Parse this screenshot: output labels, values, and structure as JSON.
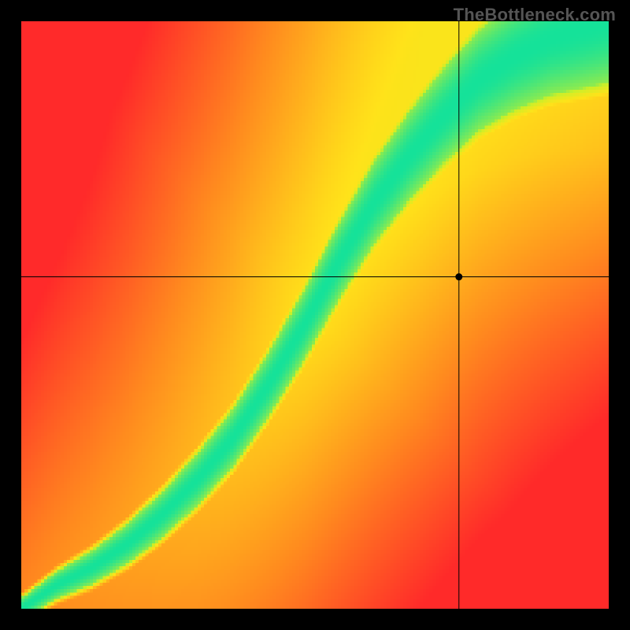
{
  "watermark": "TheBottleneck.com",
  "colors": {
    "red": "#ff2a2a",
    "orange": "#ff8a1f",
    "yellow": "#ffe31a",
    "lime": "#c9f02a",
    "green": "#15e29a"
  },
  "chart_data": {
    "type": "heatmap",
    "title": "",
    "xlabel": "",
    "ylabel": "",
    "xlim": [
      0,
      1
    ],
    "ylim": [
      0,
      1
    ],
    "grid": false,
    "legend": false,
    "ridge": [
      {
        "x": 0.0,
        "y": 0.0
      },
      {
        "x": 0.06,
        "y": 0.04
      },
      {
        "x": 0.12,
        "y": 0.07
      },
      {
        "x": 0.18,
        "y": 0.11
      },
      {
        "x": 0.24,
        "y": 0.16
      },
      {
        "x": 0.3,
        "y": 0.22
      },
      {
        "x": 0.36,
        "y": 0.29
      },
      {
        "x": 0.42,
        "y": 0.38
      },
      {
        "x": 0.48,
        "y": 0.48
      },
      {
        "x": 0.54,
        "y": 0.59
      },
      {
        "x": 0.6,
        "y": 0.69
      },
      {
        "x": 0.66,
        "y": 0.77
      },
      {
        "x": 0.72,
        "y": 0.84
      },
      {
        "x": 0.78,
        "y": 0.9
      },
      {
        "x": 0.84,
        "y": 0.94
      },
      {
        "x": 0.9,
        "y": 0.97
      },
      {
        "x": 1.0,
        "y": 1.0
      }
    ],
    "ridge_base_width": 0.018,
    "ridge_width_gain": 0.085,
    "crosshair": {
      "x": 0.745,
      "y": 0.565
    },
    "marker_radius_px": 4.5
  }
}
